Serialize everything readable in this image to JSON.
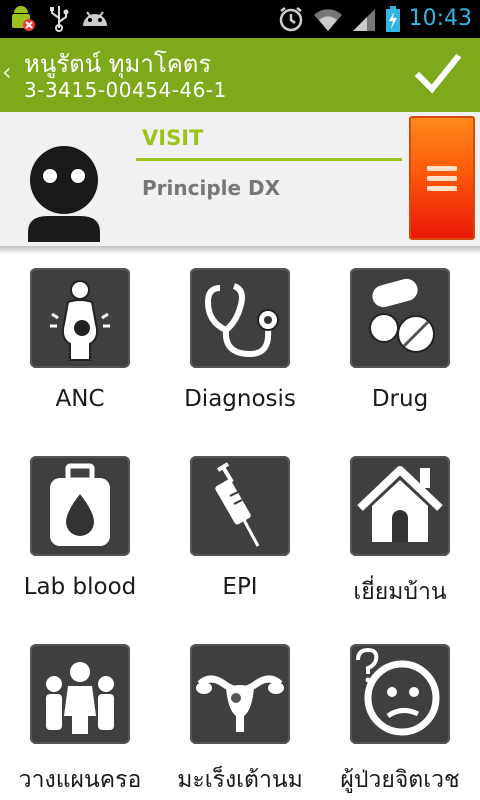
{
  "status_bar": {
    "time": "10:43",
    "icons_left": [
      "android-warning-icon",
      "usb-icon",
      "android-debug-icon"
    ],
    "icons_right": [
      "alarm-icon",
      "wifi-icon",
      "signal-icon",
      "battery-icon"
    ]
  },
  "action_bar": {
    "title": "หนูรัตน์ ทุมาโคตร",
    "subtitle": "3-3415-00454-46-1",
    "back_icon": "chevron-left-icon",
    "confirm_icon": "checkmark-icon"
  },
  "header": {
    "visit_label": "VISIT",
    "diagnosis_label": "Principle DX",
    "menu_icon": "hamburger-menu-icon",
    "colors": {
      "accent": "#9bc31e",
      "action_bar": "#7ea91a",
      "menu_button": "#ff5a0a"
    }
  },
  "tiles": [
    {
      "label": "ANC",
      "icon": "pregnant-woman-icon"
    },
    {
      "label": "Diagnosis",
      "icon": "stethoscope-icon"
    },
    {
      "label": "Drug",
      "icon": "pills-icon"
    },
    {
      "label": "Lab blood",
      "icon": "blood-drop-icon"
    },
    {
      "label": "EPI",
      "icon": "syringe-icon"
    },
    {
      "label": "เยี่ยมบ้าน",
      "icon": "house-icon"
    },
    {
      "label": "วางแผนครอ",
      "icon": "family-icon"
    },
    {
      "label": "มะเร็งเต้านม",
      "icon": "uterus-icon"
    },
    {
      "label": "ผู้ป่วยจิตเวช",
      "icon": "confused-face-icon"
    }
  ]
}
